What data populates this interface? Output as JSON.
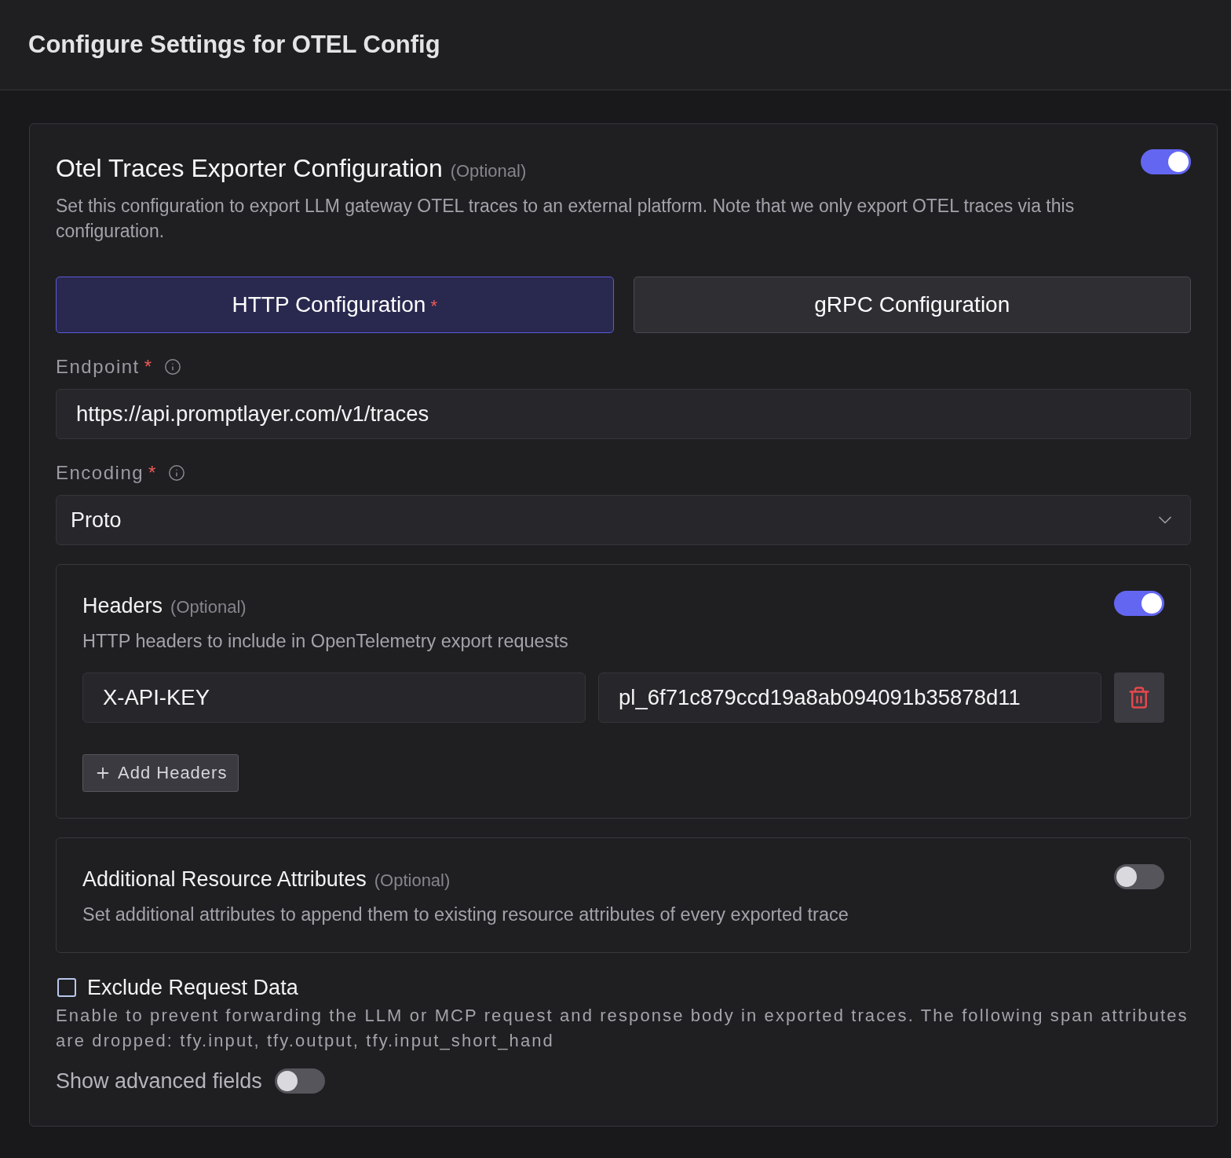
{
  "header": {
    "title": "Configure Settings for OTEL Config"
  },
  "exporter": {
    "title": "Otel Traces Exporter Configuration",
    "optional_label": "(Optional)",
    "on": true,
    "description": "Set this configuration to export LLM gateway OTEL traces to an external platform. Note that we only export OTEL traces via this configuration.",
    "tabs": [
      {
        "label": "HTTP Configuration",
        "required_mark": "*",
        "selected": true
      },
      {
        "label": "gRPC Configuration",
        "selected": false
      }
    ],
    "fields": [
      {
        "kind": "text",
        "label": "Endpoint",
        "required_mark": "*",
        "value": "https://api.promptlayer.com/v1/traces"
      },
      {
        "kind": "select",
        "label": "Encoding",
        "required_mark": "*",
        "value": "Proto"
      }
    ],
    "sections": [
      {
        "title": "Headers",
        "optional_label": "(Optional)",
        "on": true,
        "description": "HTTP headers to include in OpenTelemetry export requests",
        "rows": [
          {
            "key": "X-API-KEY",
            "value": "pl_6f71c879ccd19a8ab094091b35878d11"
          }
        ],
        "add_button": "Add Headers"
      },
      {
        "title": "Additional Resource Attributes",
        "optional_label": "(Optional)",
        "on": false,
        "description": "Set additional attributes to append them to existing resource attributes of every exported trace"
      }
    ],
    "exclude_request_data": {
      "label": "Exclude Request Data",
      "checked": false,
      "description": "Enable to prevent forwarding the LLM or MCP request and response body in exported traces. The following span attributes are dropped: tfy.input, tfy.output, tfy.input_short_hand"
    },
    "advanced_fields": {
      "label": "Show advanced fields",
      "on": false
    }
  }
}
